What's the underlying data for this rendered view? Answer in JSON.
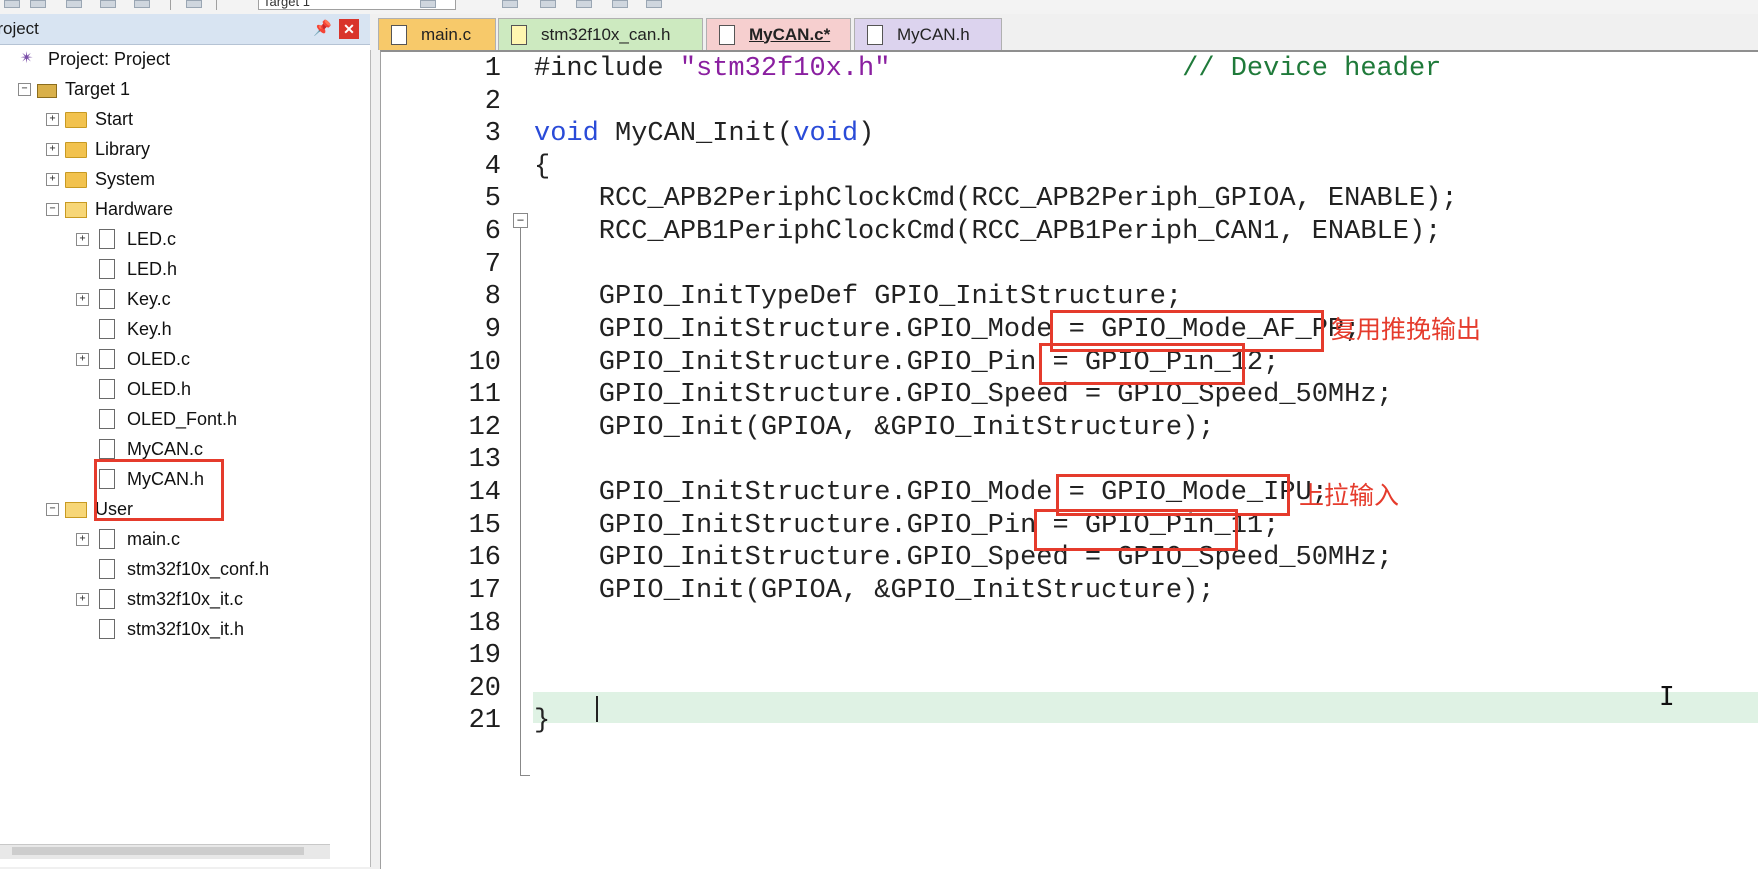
{
  "toolbar": {
    "target_select": "Target 1"
  },
  "project_panel": {
    "title": "Project",
    "tree": [
      {
        "label": "Project: Project"
      },
      {
        "label": "Target 1"
      },
      {
        "label": "Start"
      },
      {
        "label": "Library"
      },
      {
        "label": "System"
      },
      {
        "label": "Hardware"
      },
      {
        "label": "LED.c"
      },
      {
        "label": "LED.h"
      },
      {
        "label": "Key.c"
      },
      {
        "label": "Key.h"
      },
      {
        "label": "OLED.c"
      },
      {
        "label": "OLED.h"
      },
      {
        "label": "OLED_Font.h"
      },
      {
        "label": "MyCAN.c"
      },
      {
        "label": "MyCAN.h"
      },
      {
        "label": "User"
      },
      {
        "label": "main.c"
      },
      {
        "label": "stm32f10x_conf.h"
      },
      {
        "label": "stm32f10x_it.c"
      },
      {
        "label": "stm32f10x_it.h"
      }
    ]
  },
  "tabs": [
    {
      "label": "main.c"
    },
    {
      "label": "stm32f10x_can.h"
    },
    {
      "label": "MyCAN.c*"
    },
    {
      "label": "MyCAN.h"
    }
  ],
  "editor": {
    "line_numbers": [
      "1",
      "2",
      "3",
      "4",
      "5",
      "6",
      "7",
      "8",
      "9",
      "10",
      "11",
      "12",
      "13",
      "14",
      "15",
      "16",
      "17",
      "18",
      "19",
      "20",
      "21"
    ],
    "lines": {
      "l1_a": "#include ",
      "l1_b": "\"stm32f10x.h\"",
      "l1_c": "                  // Device header",
      "l3_a": "void",
      "l3_b": " MyCAN_Init(",
      "l3_c": "void",
      "l3_d": ")",
      "l4": "{",
      "l5": "    RCC_APB2PeriphClockCmd(RCC_APB2Periph_GPIOA, ENABLE);",
      "l6": "    RCC_APB1PeriphClockCmd(RCC_APB1Periph_CAN1, ENABLE);",
      "l8": "    GPIO_InitTypeDef GPIO_InitStructure;",
      "l9": "    GPIO_InitStructure.GPIO_Mode = GPIO_Mode_AF_PP;",
      "l10": "    GPIO_InitStructure.GPIO_Pin = GPIO_Pin_12;",
      "l11": "    GPIO_InitStructure.GPIO_Speed = GPIO_Speed_50MHz;",
      "l12": "    GPIO_Init(GPIOA, &GPIO_InitStructure);",
      "l14": "    GPIO_InitStructure.GPIO_Mode = GPIO_Mode_IPU;",
      "l15": "    GPIO_InitStructure.GPIO_Pin = GPIO_Pin_11;",
      "l16": "    GPIO_InitStructure.GPIO_Speed = GPIO_Speed_50MHz;",
      "l17": "    GPIO_Init(GPIOA, &GPIO_InitStructure);",
      "l19": "    ",
      "l20": "}"
    }
  },
  "annotations": {
    "af_pp": "复用推挽输出",
    "ipu": "上拉输入"
  },
  "colors": {
    "keyword": "#2a4bd8",
    "string": "#8a1fa0",
    "comment": "#1f7a3a",
    "highlight_red": "#e53b2c"
  }
}
